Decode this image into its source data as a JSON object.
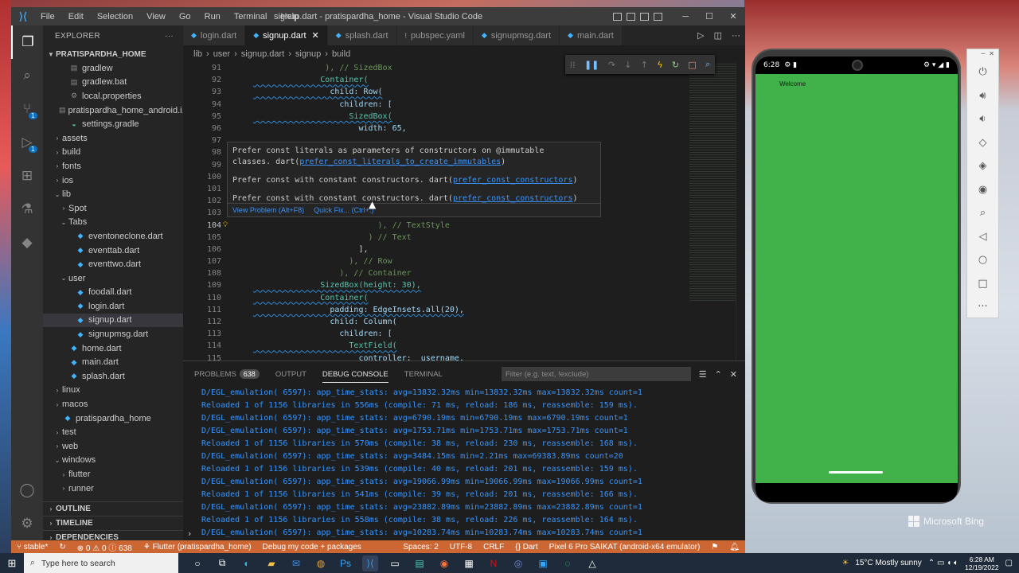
{
  "window": {
    "title": "signup.dart - pratispardha_home - Visual Studio Code",
    "menu": [
      "File",
      "Edit",
      "Selection",
      "View",
      "Go",
      "Run",
      "Terminal",
      "Help"
    ]
  },
  "activity_badges": {
    "source_control": "1",
    "run_debug": "1"
  },
  "sidebar": {
    "header": "EXPLORER",
    "project": "PRATISPARDHA_HOME",
    "tree": [
      {
        "label": "gradlew",
        "depth": 2,
        "kind": "file",
        "icon": "file-icon"
      },
      {
        "label": "gradlew.bat",
        "depth": 2,
        "kind": "file",
        "icon": "file-icon"
      },
      {
        "label": "local.properties",
        "depth": 2,
        "kind": "file",
        "icon": "gear-icon"
      },
      {
        "label": "pratispardha_home_android.i...",
        "depth": 2,
        "kind": "file",
        "icon": "file-icon"
      },
      {
        "label": "settings.gradle",
        "depth": 2,
        "kind": "file",
        "icon": "gradle-icon"
      },
      {
        "label": "assets",
        "depth": 1,
        "kind": "folder",
        "open": false
      },
      {
        "label": "build",
        "depth": 1,
        "kind": "folder",
        "open": false
      },
      {
        "label": "fonts",
        "depth": 1,
        "kind": "folder",
        "open": false
      },
      {
        "label": "ios",
        "depth": 1,
        "kind": "folder",
        "open": false
      },
      {
        "label": "lib",
        "depth": 1,
        "kind": "folder",
        "open": true
      },
      {
        "label": "Spot",
        "depth": 2,
        "kind": "folder",
        "open": false
      },
      {
        "label": "Tabs",
        "depth": 2,
        "kind": "folder",
        "open": true
      },
      {
        "label": "eventoneclone.dart",
        "depth": 3,
        "kind": "file",
        "icon": "dart-icon"
      },
      {
        "label": "eventtab.dart",
        "depth": 3,
        "kind": "file",
        "icon": "dart-icon"
      },
      {
        "label": "eventtwo.dart",
        "depth": 3,
        "kind": "file",
        "icon": "dart-icon"
      },
      {
        "label": "user",
        "depth": 2,
        "kind": "folder",
        "open": true
      },
      {
        "label": "foodall.dart",
        "depth": 3,
        "kind": "file",
        "icon": "dart-icon"
      },
      {
        "label": "login.dart",
        "depth": 3,
        "kind": "file",
        "icon": "dart-icon"
      },
      {
        "label": "signup.dart",
        "depth": 3,
        "kind": "file",
        "icon": "dart-icon",
        "selected": true
      },
      {
        "label": "signupmsg.dart",
        "depth": 3,
        "kind": "file",
        "icon": "dart-icon"
      },
      {
        "label": "home.dart",
        "depth": 2,
        "kind": "file",
        "icon": "dart-icon"
      },
      {
        "label": "main.dart",
        "depth": 2,
        "kind": "file",
        "icon": "dart-icon"
      },
      {
        "label": "splash.dart",
        "depth": 2,
        "kind": "file",
        "icon": "dart-icon"
      },
      {
        "label": "linux",
        "depth": 1,
        "kind": "folder",
        "open": false
      },
      {
        "label": "macos",
        "depth": 1,
        "kind": "folder",
        "open": false
      },
      {
        "label": "pratispardha_home",
        "depth": 1,
        "kind": "file",
        "icon": "dart-icon"
      },
      {
        "label": "test",
        "depth": 1,
        "kind": "folder",
        "open": false
      },
      {
        "label": "web",
        "depth": 1,
        "kind": "folder",
        "open": false
      },
      {
        "label": "windows",
        "depth": 1,
        "kind": "folder",
        "open": true
      },
      {
        "label": "flutter",
        "depth": 2,
        "kind": "folder",
        "open": false
      },
      {
        "label": "runner",
        "depth": 2,
        "kind": "folder",
        "open": false
      }
    ],
    "outline": "OUTLINE",
    "timeline": "TIMELINE",
    "dependencies": "DEPENDENCIES"
  },
  "tabs": [
    {
      "label": "login.dart",
      "active": false
    },
    {
      "label": "signup.dart",
      "active": true
    },
    {
      "label": "splash.dart",
      "active": false
    },
    {
      "label": "pubspec.yaml",
      "active": false
    },
    {
      "label": "signupmsg.dart",
      "active": false
    },
    {
      "label": "main.dart",
      "active": false
    }
  ],
  "breadcrumbs": [
    "lib",
    "user",
    "signup.dart",
    "signup",
    "build"
  ],
  "code_lines": [
    {
      "n": "91",
      "text": "               ), // SizedBox"
    },
    {
      "n": "92",
      "text": "              Container("
    },
    {
      "n": "93",
      "text": "                child: Row("
    },
    {
      "n": "94",
      "text": "                  children: ["
    },
    {
      "n": "95",
      "text": "                    SizedBox("
    },
    {
      "n": "96",
      "text": "                      width: 65,"
    },
    {
      "n": "97",
      "text": ""
    },
    {
      "n": "98",
      "text": ""
    },
    {
      "n": "99",
      "text": ""
    },
    {
      "n": "100",
      "text": ""
    },
    {
      "n": "101",
      "text": ""
    },
    {
      "n": "102",
      "text": ""
    },
    {
      "n": "103",
      "text": ""
    },
    {
      "n": "104",
      "text": "                          ), // TextStyle"
    },
    {
      "n": "105",
      "text": "                        ) // Text"
    },
    {
      "n": "106",
      "text": "                      ],"
    },
    {
      "n": "107",
      "text": "                    ), // Row"
    },
    {
      "n": "108",
      "text": "                  ), // Container"
    },
    {
      "n": "109",
      "text": "              SizedBox(height: 30),"
    },
    {
      "n": "110",
      "text": "              Container("
    },
    {
      "n": "111",
      "text": "                padding: EdgeInsets.all(20),"
    },
    {
      "n": "112",
      "text": "                child: Column("
    },
    {
      "n": "113",
      "text": "                  children: ["
    },
    {
      "n": "114",
      "text": "                    TextField("
    },
    {
      "n": "115",
      "text": "                      controller: _username,"
    }
  ],
  "hover": {
    "line1": "Prefer const literals as parameters of constructors on @immutable",
    "line2_prefix": "classes. dart(",
    "line2_link": "prefer_const_literals_to_create_immutables",
    "line3_prefix": "Prefer const with constant constructors. dart(",
    "line3_link": "prefer_const_constructors",
    "line4_prefix": "Prefer const with constant constructors. dart(",
    "line4_link": "prefer_const_constructors",
    "close_paren": ")",
    "view_problem": "View Problem (Alt+F8)",
    "quick_fix": "Quick Fix... (Ctrl+.)"
  },
  "panel": {
    "tabs": {
      "problems": "PROBLEMS",
      "problems_count": "638",
      "output": "OUTPUT",
      "debug_console": "DEBUG CONSOLE",
      "terminal": "TERMINAL"
    },
    "filter_placeholder": "Filter (e.g. text, !exclude)",
    "console_lines": [
      "D/EGL_emulation( 6597): app_time_stats: avg=13832.32ms min=13832.32ms max=13832.32ms count=1",
      "Reloaded 1 of 1156 libraries in 556ms (compile: 71 ms, reload: 186 ms, reassemble: 159 ms).",
      "D/EGL_emulation( 6597): app_time_stats: avg=6790.19ms min=6790.19ms max=6790.19ms count=1",
      "D/EGL_emulation( 6597): app_time_stats: avg=1753.71ms min=1753.71ms max=1753.71ms count=1",
      "Reloaded 1 of 1156 libraries in 570ms (compile: 38 ms, reload: 230 ms, reassemble: 168 ms).",
      "D/EGL_emulation( 6597): app_time_stats: avg=3484.15ms min=2.21ms max=69383.89ms count=20",
      "Reloaded 1 of 1156 libraries in 539ms (compile: 40 ms, reload: 201 ms, reassemble: 159 ms).",
      "D/EGL_emulation( 6597): app_time_stats: avg=19066.99ms min=19066.99ms max=19066.99ms count=1",
      "Reloaded 1 of 1156 libraries in 541ms (compile: 39 ms, reload: 201 ms, reassemble: 166 ms).",
      "D/EGL_emulation( 6597): app_time_stats: avg=23882.89ms min=23882.89ms max=23882.89ms count=1",
      "Reloaded 1 of 1156 libraries in 558ms (compile: 38 ms, reload: 226 ms, reassemble: 164 ms).",
      "D/EGL_emulation( 6597): app_time_stats: avg=10283.74ms min=10283.74ms max=10283.74ms count=1"
    ]
  },
  "status": {
    "branch": "stable*",
    "errors": "0",
    "warnings": "0",
    "infos": "638",
    "flutter": "Flutter (pratispardha_home)",
    "debug_config": "Debug my code + packages",
    "spaces": "Spaces: 2",
    "encoding": "UTF-8",
    "eol": "CRLF",
    "language": "Dart",
    "device": "Pixel 6 Pro SAIKAT (android-x64 emulator)"
  },
  "emulator": {
    "time": "6:28",
    "app_text": "Welcome",
    "app_color": "#41b24a"
  },
  "taskbar": {
    "search_placeholder": "Type here to search",
    "weather": "15°C  Mostly sunny",
    "time": "6:28 AM",
    "date": "12/19/2022"
  },
  "watermark": "Microsoft Bing",
  "colors": {
    "status_bar": "#cc6633",
    "accent": "#0e70c0",
    "console_text": "#3794ff"
  }
}
